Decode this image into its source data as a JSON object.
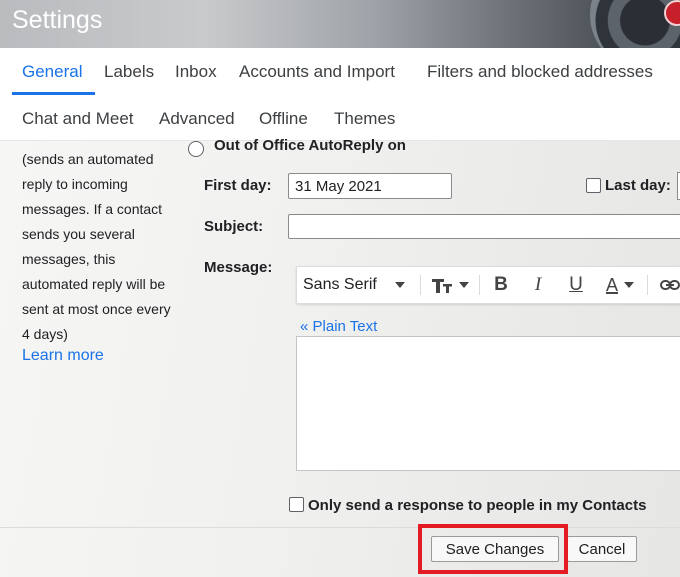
{
  "header": {
    "title": "Settings"
  },
  "tabs": [
    {
      "label": "General",
      "active": true
    },
    {
      "label": "Labels"
    },
    {
      "label": "Inbox"
    },
    {
      "label": "Accounts and Import"
    },
    {
      "label": "Filters and blocked addresses"
    },
    {
      "label": "Chat and Meet"
    },
    {
      "label": "Advanced"
    },
    {
      "label": "Offline"
    },
    {
      "label": "Themes"
    }
  ],
  "vacation": {
    "description_lines": [
      "(sends an automated",
      "reply to incoming",
      "messages. If a contact",
      "sends you several",
      "messages, this",
      "automated reply will be",
      "sent at most once every",
      "4 days)"
    ],
    "learn_more": "Learn more",
    "ooo_on_label": "Out of Office AutoReply on",
    "first_day_label": "First day:",
    "first_day_value": "31 May 2021",
    "last_day_label": "Last day:",
    "subject_label": "Subject:",
    "subject_value": "",
    "message_label": "Message:",
    "font_name": "Sans Serif",
    "plain_text_link": "« Plain Text",
    "contacts_only_label": "Only send a response to people in my Contacts"
  },
  "buttons": {
    "save": "Save Changes",
    "cancel": "Cancel"
  },
  "colors": {
    "accent": "#1a73e8",
    "highlight": "#e31b23"
  }
}
